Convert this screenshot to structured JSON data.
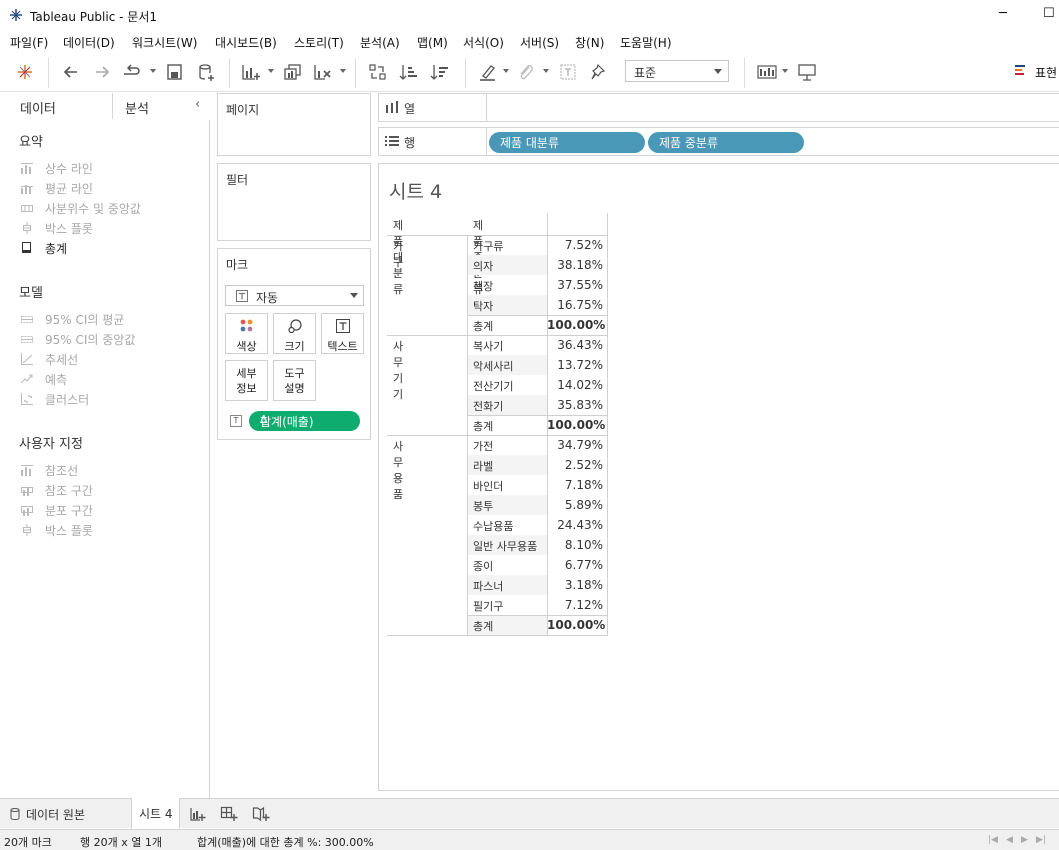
{
  "window": {
    "title": "Tableau Public - 문서1",
    "minimize": "─",
    "maximize": "☐"
  },
  "menu": [
    "파일(F)",
    "데이터(D)",
    "워크시트(W)",
    "대시보드(B)",
    "스토리(T)",
    "분석(A)",
    "맵(M)",
    "서식(O)",
    "서버(S)",
    "창(N)",
    "도움말(H)"
  ],
  "toolbar": {
    "fit": "표준",
    "show_me": "표현"
  },
  "left_pane": {
    "tab_data": "데이터",
    "tab_analysis": "분석",
    "collapse": "‹",
    "summary": {
      "heading": "요약",
      "items": [
        {
          "label": "상수 라인",
          "icon": "constant-line-icon",
          "enabled": false
        },
        {
          "label": "평균 라인",
          "icon": "average-line-icon",
          "enabled": false
        },
        {
          "label": "사분위수 및 중앙값",
          "icon": "quartile-icon",
          "enabled": false
        },
        {
          "label": "박스 플롯",
          "icon": "box-plot-icon",
          "enabled": false
        },
        {
          "label": "총계",
          "icon": "totals-icon",
          "enabled": true
        }
      ]
    },
    "model": {
      "heading": "모델",
      "items": [
        {
          "label": "95% CI의 평균",
          "icon": "ci-mean-icon",
          "enabled": false
        },
        {
          "label": "95% CI의 중앙값",
          "icon": "ci-median-icon",
          "enabled": false
        },
        {
          "label": "추세선",
          "icon": "trend-line-icon",
          "enabled": false
        },
        {
          "label": "예측",
          "icon": "forecast-icon",
          "enabled": false
        },
        {
          "label": "클러스터",
          "icon": "cluster-icon",
          "enabled": false
        }
      ]
    },
    "custom": {
      "heading": "사용자 지정",
      "items": [
        {
          "label": "참조선",
          "icon": "reference-line-icon",
          "enabled": false
        },
        {
          "label": "참조 구간",
          "icon": "reference-band-icon",
          "enabled": false
        },
        {
          "label": "분포 구간",
          "icon": "distribution-band-icon",
          "enabled": false
        },
        {
          "label": "박스 플롯",
          "icon": "box-plot-icon",
          "enabled": false
        }
      ]
    }
  },
  "cards": {
    "pages": "페이지",
    "filters": "필터",
    "marks": {
      "title": "마크",
      "type": "자동",
      "color": "색상",
      "size": "크기",
      "text": "텍스트",
      "detail": [
        "세부",
        "정보"
      ],
      "tooltip": [
        "도구",
        "설명"
      ],
      "pill": "합계(매출)",
      "pill_delta": "Δ"
    }
  },
  "shelves": {
    "columns_label": "열",
    "rows_label": "행",
    "row_pills": [
      "제품 대분류",
      "제품 중분류"
    ]
  },
  "sheet": {
    "title": "시트 4",
    "col_headers": [
      "제품 대분류",
      "제품 중분류"
    ],
    "groups": [
      {
        "category": "가구",
        "rows": [
          [
            "가구류",
            "7.52%"
          ],
          [
            "의자",
            "38.18%"
          ],
          [
            "책장",
            "37.55%"
          ],
          [
            "탁자",
            "16.75%"
          ],
          [
            "총계",
            "100.00%"
          ]
        ]
      },
      {
        "category": "사무기기",
        "rows": [
          [
            "복사기",
            "36.43%"
          ],
          [
            "악세사리",
            "13.72%"
          ],
          [
            "전산기기",
            "14.02%"
          ],
          [
            "전화기",
            "35.83%"
          ],
          [
            "총계",
            "100.00%"
          ]
        ]
      },
      {
        "category": "사무용품",
        "rows": [
          [
            "가전",
            "34.79%"
          ],
          [
            "라벨",
            "2.52%"
          ],
          [
            "바인더",
            "7.18%"
          ],
          [
            "봉투",
            "5.89%"
          ],
          [
            "수납용품",
            "24.43%"
          ],
          [
            "일반 사무용품",
            "8.10%"
          ],
          [
            "종이",
            "6.77%"
          ],
          [
            "파스너",
            "3.18%"
          ],
          [
            "필기구",
            "7.12%"
          ],
          [
            "총계",
            "100.00%"
          ]
        ]
      }
    ]
  },
  "bottom": {
    "data_source": "데이터 원본",
    "sheet_tab": "시트 4"
  },
  "status": {
    "marks": "20개 마크",
    "rows_cols": "행 20개  x  열 1개",
    "total": "합계(매출)에 대한 총계 %: 300.00%"
  },
  "colors": {
    "dimension_pill": "#4a98b7",
    "measure_pill": "#0fac6f",
    "tableau_logo": "#1f457e"
  }
}
